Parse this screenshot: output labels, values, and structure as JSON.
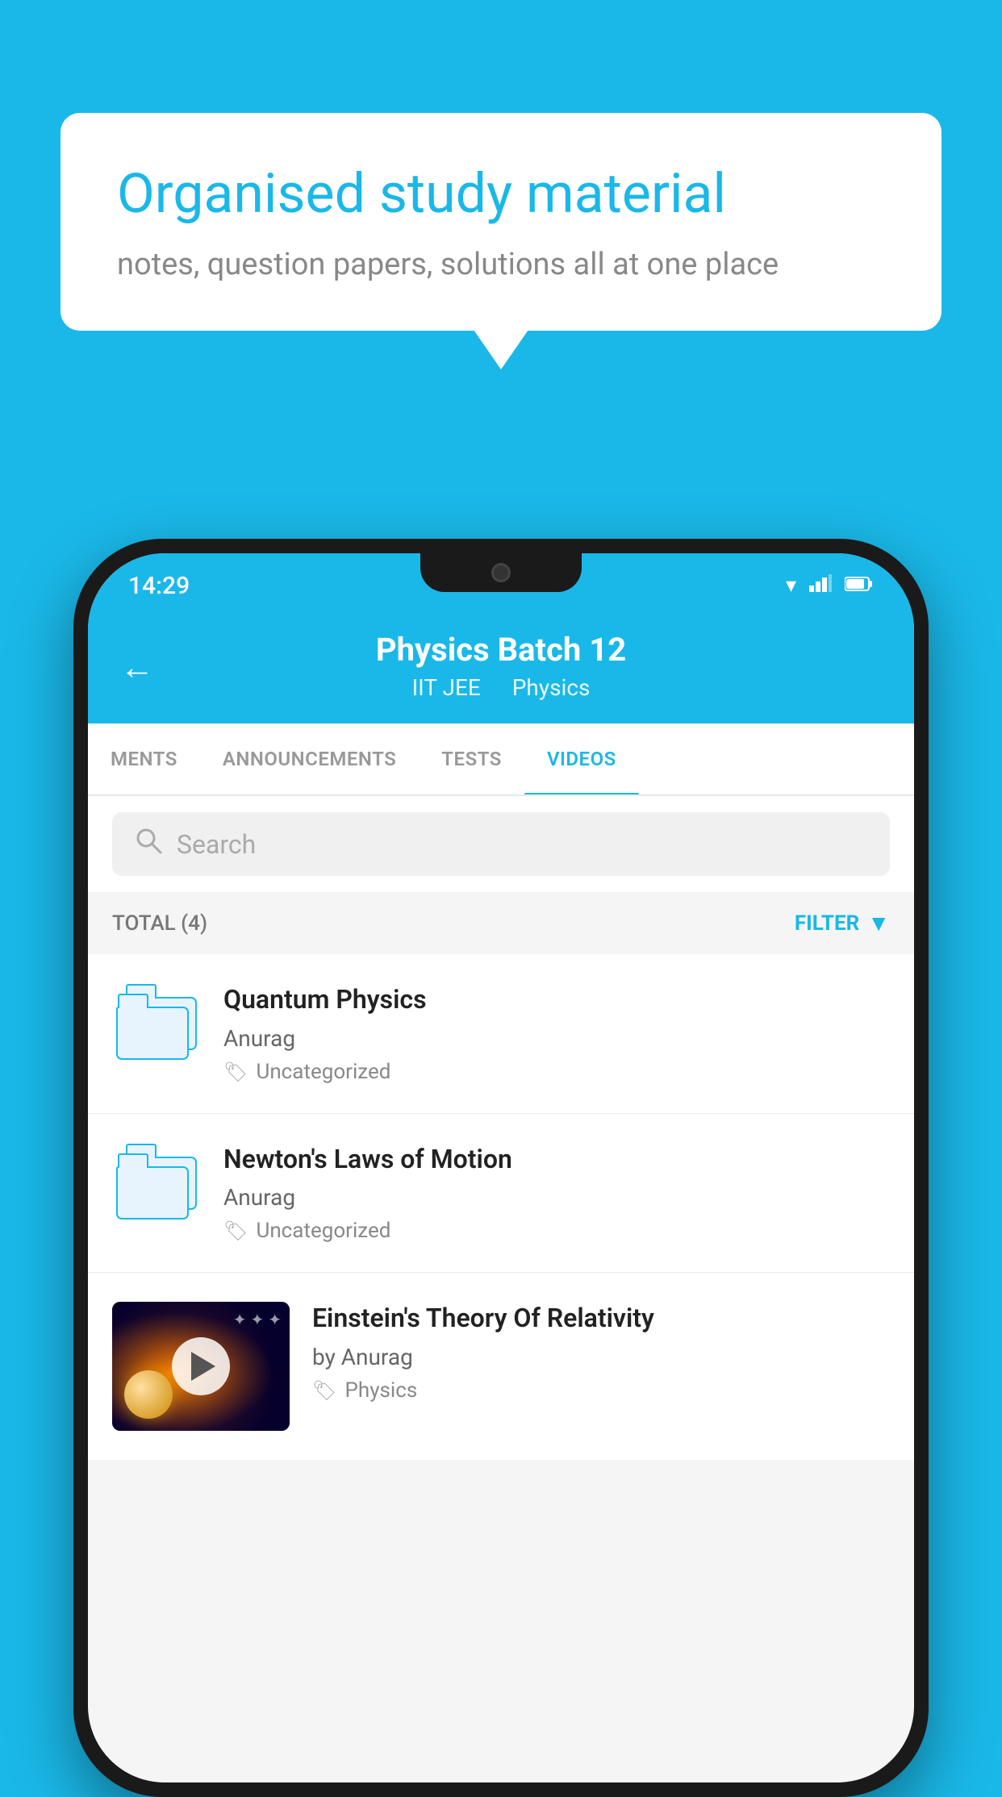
{
  "background_color": "#1ab8e8",
  "bubble": {
    "title": "Organised study material",
    "subtitle": "notes, question papers, solutions all at one place"
  },
  "status_bar": {
    "time": "14:29",
    "icons": [
      "wifi",
      "signal",
      "battery"
    ]
  },
  "header": {
    "title": "Physics Batch 12",
    "subtitle_part1": "IIT JEE",
    "subtitle_part2": "Physics",
    "back_label": "←"
  },
  "tabs": [
    {
      "label": "MENTS",
      "active": false
    },
    {
      "label": "ANNOUNCEMENTS",
      "active": false
    },
    {
      "label": "TESTS",
      "active": false
    },
    {
      "label": "VIDEOS",
      "active": true
    }
  ],
  "search": {
    "placeholder": "Search"
  },
  "filter_bar": {
    "total_label": "TOTAL (4)",
    "filter_label": "FILTER"
  },
  "videos": [
    {
      "title": "Quantum Physics",
      "author": "Anurag",
      "tag": "Uncategorized",
      "type": "folder"
    },
    {
      "title": "Newton's Laws of Motion",
      "author": "Anurag",
      "tag": "Uncategorized",
      "type": "folder"
    },
    {
      "title": "Einstein's Theory Of Relativity",
      "author": "by Anurag",
      "tag": "Physics",
      "type": "video"
    }
  ]
}
